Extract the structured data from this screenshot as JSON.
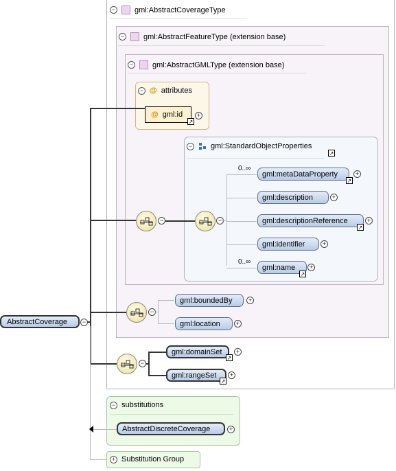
{
  "abstract_coverage_type": {
    "label": "gml:AbstractCoverageType"
  },
  "abstract_feature_type": {
    "label": "gml:AbstractFeatureType (extension base)"
  },
  "abstract_gml_type": {
    "label": "gml:AbstractGMLType (extension base)"
  },
  "attributes": {
    "label": "attributes",
    "id_attr": "gml:id"
  },
  "standard_object_properties": {
    "label": "gml:StandardObjectProperties",
    "items": [
      {
        "label": "gml:metaDataProperty",
        "occurrence": "0..∞"
      },
      {
        "label": "gml:description",
        "occurrence": ""
      },
      {
        "label": "gml:descriptionReference",
        "occurrence": ""
      },
      {
        "label": "gml:identifier",
        "occurrence": ""
      },
      {
        "label": "gml:name",
        "occurrence": "0..∞"
      }
    ]
  },
  "feature_elements": [
    "gml:boundedBy",
    "gml:location"
  ],
  "coverage_elements": [
    "gml:domainSet",
    "gml:rangeSet"
  ],
  "root": {
    "label": "AbstractCoverage"
  },
  "substitutions": {
    "label": "substitutions",
    "item": "AbstractDiscreteCoverage"
  },
  "substitution_group": {
    "label": "Substitution Group"
  },
  "colors": {
    "complex_type_bg": "#f7f3f8",
    "group_bg": "#f4f7fc",
    "attr_bg": "#fdf7e8",
    "subst_bg": "#eefae8"
  }
}
